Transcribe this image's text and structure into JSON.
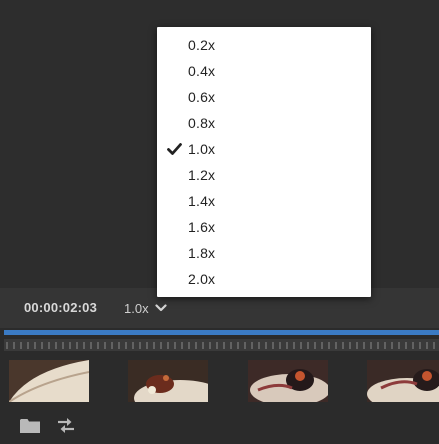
{
  "player": {
    "timecode": "00:00:02:03",
    "speed_label": "1.0x"
  },
  "speed_menu": {
    "items": [
      {
        "label": "0.2x",
        "checked": false
      },
      {
        "label": "0.4x",
        "checked": false
      },
      {
        "label": "0.6x",
        "checked": false
      },
      {
        "label": "0.8x",
        "checked": false
      },
      {
        "label": "1.0x",
        "checked": true
      },
      {
        "label": "1.2x",
        "checked": false
      },
      {
        "label": "1.4x",
        "checked": false
      },
      {
        "label": "1.6x",
        "checked": false
      },
      {
        "label": "1.8x",
        "checked": false
      },
      {
        "label": "2.0x",
        "checked": false
      }
    ]
  },
  "timeline": {
    "thumbnail_count": 4
  },
  "icons": {
    "speed_dropdown": "chevron-down-icon",
    "selected": "checkmark-icon",
    "folder": "folder-icon",
    "swap": "swap-arrows-icon"
  },
  "colors": {
    "accent": "#3b7bc4",
    "menu_background": "#ffffff",
    "panel_background": "#2b2b2b"
  }
}
